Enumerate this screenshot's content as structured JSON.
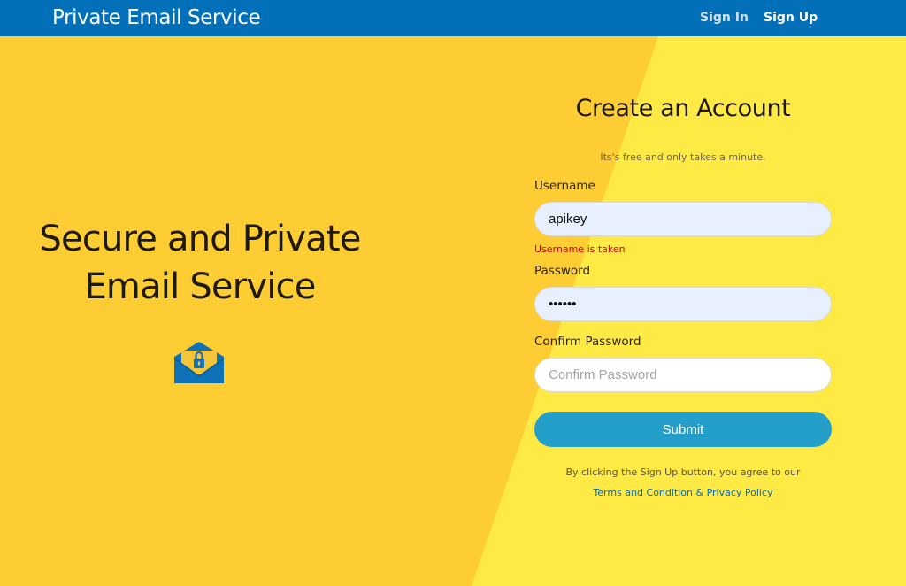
{
  "navbar": {
    "brand": "Private Email Service",
    "sign_in": "Sign In",
    "sign_up": "Sign Up"
  },
  "hero": {
    "title_line1": "Secure and Private",
    "title_line2": "Email Service",
    "icon": "envelope-lock-icon"
  },
  "form": {
    "title": "Create an Account",
    "subtitle": "Its's free and only takes a minute.",
    "username": {
      "label": "Username",
      "value": "apikey",
      "error": "Username is taken"
    },
    "password": {
      "label": "Password",
      "value": "123456"
    },
    "confirm_password": {
      "label": "Confirm Password",
      "value": "",
      "placeholder": "Confirm Password"
    },
    "submit_label": "Submit",
    "agreement_text": "By clicking the Sign Up button, you agree to our",
    "terms_link": "Terms and Condition & Privacy Policy"
  },
  "colors": {
    "navbar": "#0170b9",
    "background_left": "#fecd34",
    "background_right": "#ffe945",
    "submit": "#239fc9",
    "error": "#d0021b",
    "link": "#0b6ba8"
  }
}
